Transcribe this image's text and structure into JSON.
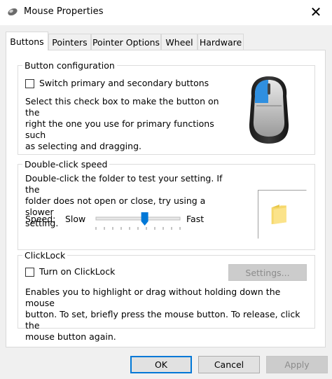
{
  "window": {
    "title": "Mouse Properties",
    "close_glyph": "✕"
  },
  "tabs": [
    {
      "label": "Buttons",
      "active": true
    },
    {
      "label": "Pointers",
      "active": false
    },
    {
      "label": "Pointer Options",
      "active": false
    },
    {
      "label": "Wheel",
      "active": false
    },
    {
      "label": "Hardware",
      "active": false
    }
  ],
  "button_configuration": {
    "title": "Button configuration",
    "checkbox_label": "Switch primary and secondary buttons",
    "checked": false,
    "description_lines": [
      "Select this check box to make the button on the",
      "right the one you use for primary functions such",
      "as selecting and dragging."
    ]
  },
  "double_click": {
    "title": "Double-click speed",
    "description_lines": [
      "Double-click the folder to test your setting. If the",
      "folder does not open or close, try using a slower",
      "setting."
    ],
    "speed_label": "Speed:",
    "slow_label": "Slow",
    "fast_label": "Fast",
    "slider_value": 0.58
  },
  "clicklock": {
    "title": "ClickLock",
    "checkbox_label": "Turn on ClickLock",
    "checked": false,
    "settings_label": "Settings...",
    "description_lines": [
      "Enables you to highlight or drag without holding down the mouse",
      "button. To set, briefly press the mouse button. To release, click the",
      "mouse button again."
    ]
  },
  "footer": {
    "ok_label": "OK",
    "cancel_label": "Cancel",
    "apply_label": "Apply"
  },
  "colors": {
    "accent": "#0078d7",
    "mouse_highlight": "#2f8fe0"
  }
}
